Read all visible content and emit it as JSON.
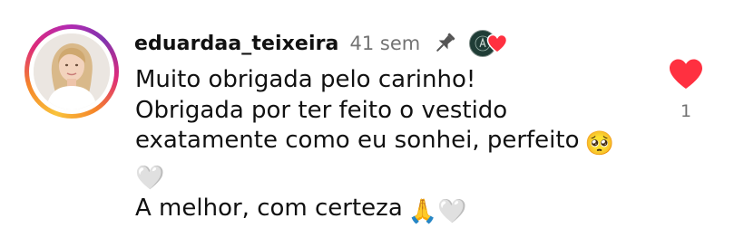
{
  "comment": {
    "username": "eduardaa_teixeira",
    "time": "41 sem",
    "lines": [
      "Muito obrigada pelo carinho!",
      "Obrigada por ter feito o vestido",
      "exatamente como eu sonhei, perfeito",
      "A melhor, com certeza"
    ],
    "emojis": {
      "pleading_face": "🥺",
      "white_heart": "🤍",
      "folded_hands": "🙏"
    },
    "like_count": "1"
  },
  "icons": {
    "pin": "pin-icon",
    "like": "heart-icon",
    "creator_like": "creator-liked-heart-icon"
  },
  "colors": {
    "like_red": "#ff3040",
    "text": "#111111",
    "secondary_text": "#737373"
  }
}
